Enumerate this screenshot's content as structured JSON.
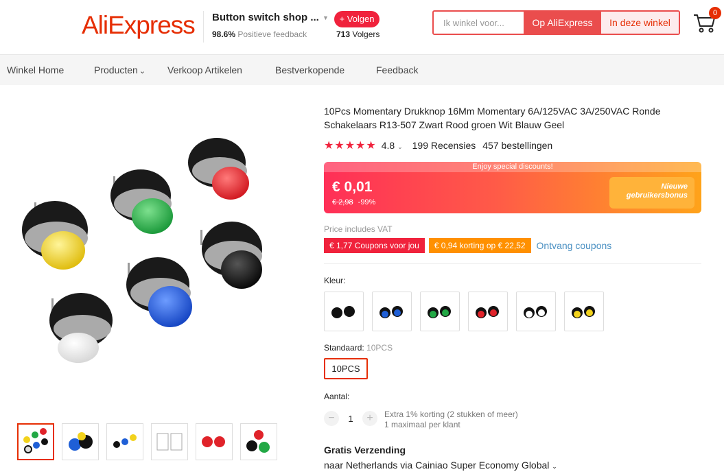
{
  "header": {
    "logo": "AliExpress",
    "shop_name": "Button switch shop ...",
    "feedback_pct": "98.6%",
    "feedback_label": "Positieve feedback",
    "follow_label": "+ Volgen",
    "followers_count": "713",
    "followers_label": "Volgers",
    "search_placeholder": "Ik winkel voor...",
    "search_ali": "Op AliExpress",
    "search_store": "In deze winkel",
    "cart_count": "0"
  },
  "nav": {
    "items": [
      "Winkel Home",
      "Producten",
      "Verkoop Artikelen",
      "Bestverkopende",
      "Feedback"
    ]
  },
  "product": {
    "title": "10Pcs Momentary Drukknop 16Mm Momentary 6A/125VAC 3A/250VAC Ronde Schakelaars R13-507 Zwart Rood groen Wit Blauw Geel",
    "rating": "4.8",
    "reviews": "199 Recensies",
    "orders": "457 bestellingen",
    "strip_text": "Enjoy special discounts!",
    "price_now": "€ 0,01",
    "price_old": "€ 2,98",
    "discount": "-99%",
    "bonus_line1": "Nieuwe",
    "bonus_line2": "gebruikersbonus",
    "vat": "Price includes VAT",
    "coupon1": "€ 1,77 Coupons voor jou",
    "coupon2": "€ 0,94 korting op € 22,52",
    "coupon_link": "Ontvang coupons",
    "color_label": "Kleur:",
    "size_label": "Standaard:",
    "size_value": "10PCS",
    "size_option": "10PCS",
    "qty_label": "Aantal:",
    "qty_value": "1",
    "qty_note1": "Extra 1% korting (2 stukken of meer)",
    "qty_note2": "1 maximaal per klant",
    "ship_title": "Gratis Verzending",
    "ship_detail": "naar Netherlands via Cainiao Super Economy Global"
  },
  "colors": {
    "accent": "#e62e04",
    "swatches": [
      "#111111",
      "#1f5fd6",
      "#22a845",
      "#e0232a",
      "#ffffff",
      "#f2d21c"
    ],
    "main_buttons": [
      "#f2d21c",
      "#22a845",
      "#e0232a",
      "#111111",
      "#1f5fd6",
      "#ffffff"
    ]
  }
}
